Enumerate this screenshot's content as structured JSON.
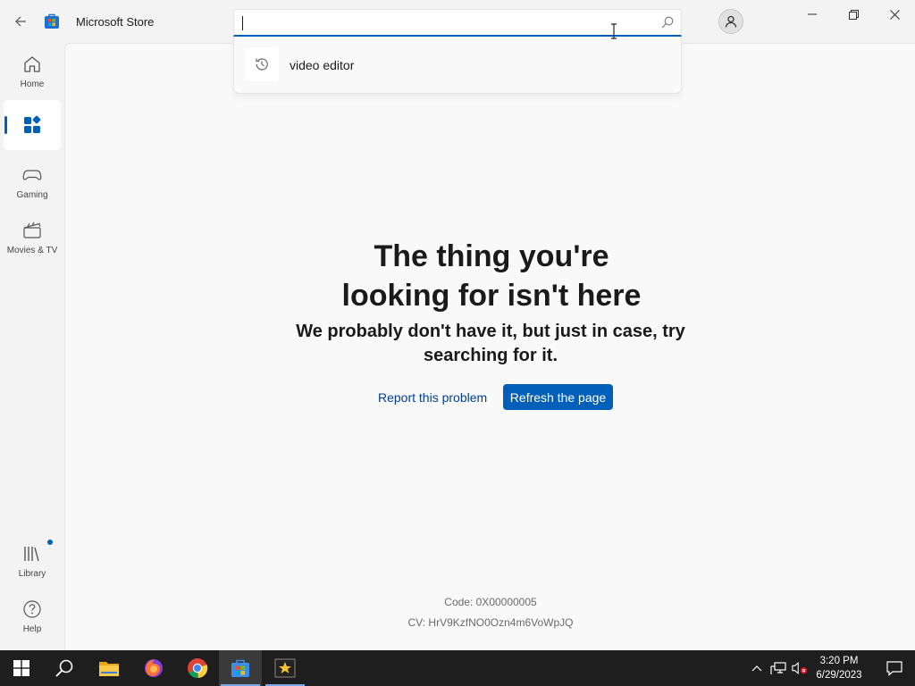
{
  "window": {
    "title": "Microsoft Store"
  },
  "search": {
    "value": "",
    "placeholder": "",
    "suggestions": [
      {
        "label": "video editor",
        "icon": "history-icon"
      }
    ]
  },
  "sidebar": {
    "items": [
      {
        "label": "Home",
        "icon": "home-icon"
      },
      {
        "label": "",
        "icon": "apps-icon",
        "active": true
      },
      {
        "label": "Gaming",
        "icon": "gamepad-icon"
      },
      {
        "label": "Movies & TV",
        "icon": "clapperboard-icon"
      },
      {
        "label": "Library",
        "icon": "library-icon",
        "has_update_badge": true
      },
      {
        "label": "Help",
        "icon": "help-icon"
      }
    ]
  },
  "error": {
    "heading": "The thing you're looking for isn't here",
    "subheading": "We probably don't have it, but just in case, try searching for it.",
    "report_label": "Report this problem",
    "refresh_label": "Refresh the page",
    "code": "Code: 0X00000005",
    "cv": "CV: HrV9KzfNO0Ozn4m6VoWpJQ"
  },
  "taskbar": {
    "apps": [
      {
        "name": "start-button",
        "icon": "windows-logo-icon"
      },
      {
        "name": "search",
        "icon": "search-icon"
      },
      {
        "name": "file-explorer",
        "icon": "folder-icon"
      },
      {
        "name": "firefox",
        "icon": "firefox-icon"
      },
      {
        "name": "chrome",
        "icon": "chrome-icon"
      },
      {
        "name": "microsoft-store",
        "icon": "store-icon",
        "active": true
      },
      {
        "name": "video-app",
        "icon": "star-clapper-icon",
        "running": true
      }
    ],
    "clock": {
      "time": "3:20 PM",
      "date": "6/29/2023"
    }
  },
  "colors": {
    "accent": "#005fb8",
    "link": "#003e92",
    "background": "#f3f3f3",
    "content": "#f9f9f9",
    "taskbar": "#1e1e1e"
  }
}
